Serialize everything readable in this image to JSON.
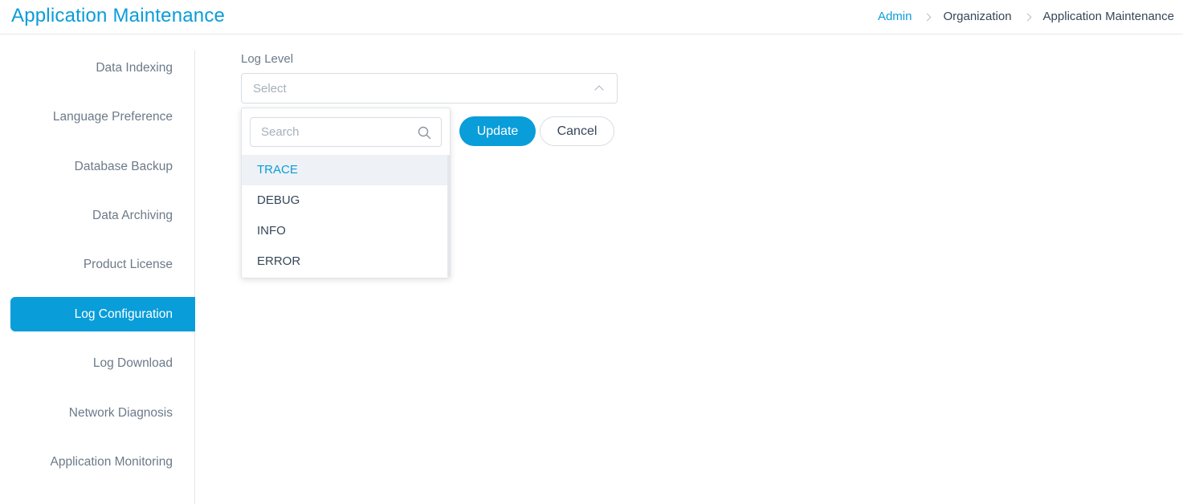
{
  "header": {
    "title": "Application Maintenance",
    "breadcrumb": [
      "Admin",
      "Organization",
      "Application Maintenance"
    ]
  },
  "sidebar": {
    "items": [
      {
        "label": "Data Indexing",
        "active": false
      },
      {
        "label": "Language Preference",
        "active": false
      },
      {
        "label": "Database Backup",
        "active": false
      },
      {
        "label": "Data Archiving",
        "active": false
      },
      {
        "label": "Product License",
        "active": false
      },
      {
        "label": "Log Configuration",
        "active": true
      },
      {
        "label": "Log Download",
        "active": false
      },
      {
        "label": "Network Diagnosis",
        "active": false
      },
      {
        "label": "Application Monitoring",
        "active": false
      }
    ]
  },
  "form": {
    "log_level_label": "Log Level",
    "select_placeholder": "Select",
    "search_placeholder": "Search",
    "options": [
      "TRACE",
      "DEBUG",
      "INFO",
      "ERROR"
    ],
    "highlighted_option": "TRACE",
    "update_label": "Update",
    "cancel_label": "Cancel"
  },
  "colors": {
    "accent": "#099dd9",
    "text": "#364658",
    "muted": "#6c7a89",
    "placeholder": "#a6b0bb",
    "border": "#d8dde3",
    "highlight_bg": "#eef1f5"
  },
  "icons": {
    "breadcrumb_separator": "chevron-right-icon",
    "select_toggle": "chevron-up-icon",
    "search": "search-icon"
  }
}
